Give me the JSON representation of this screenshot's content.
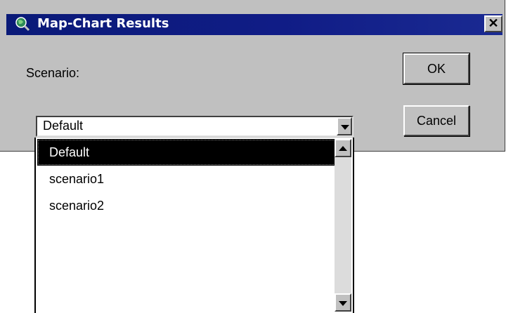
{
  "window": {
    "title": "Map-Chart Results",
    "close_glyph": "✕",
    "icon": "globe-magnifier-icon"
  },
  "form": {
    "scenario_label": "Scenario:",
    "selected_value": "Default"
  },
  "buttons": {
    "ok_label": "OK",
    "cancel_label": "Cancel"
  },
  "dropdown": {
    "items": [
      {
        "label": "Default",
        "selected": true
      },
      {
        "label": "scenario1",
        "selected": false
      },
      {
        "label": "scenario2",
        "selected": false
      }
    ]
  },
  "colors": {
    "titlebar": "#0a1a78",
    "dialog_bg": "#c0c0c0",
    "selection_bg": "#000000"
  }
}
